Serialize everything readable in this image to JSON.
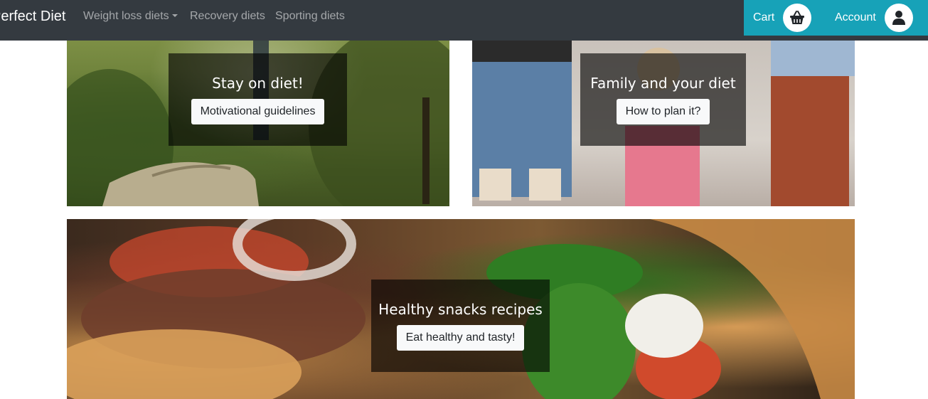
{
  "navbar": {
    "brand": "Perfect Diet",
    "links": [
      {
        "label": "Weight loss diets",
        "dropdown": true
      },
      {
        "label": "Recovery diets"
      },
      {
        "label": "Sporting diets"
      }
    ],
    "cart_label": "Cart",
    "account_label": "Account",
    "accent_color": "#17a2b8"
  },
  "cards": [
    {
      "title": "Stay on diet!",
      "button": "Motivational guidelines"
    },
    {
      "title": "Family and your diet",
      "button": "How to plan it?"
    },
    {
      "title": "Healthy snacks recipes",
      "button": "Eat healthy and tasty!"
    }
  ]
}
